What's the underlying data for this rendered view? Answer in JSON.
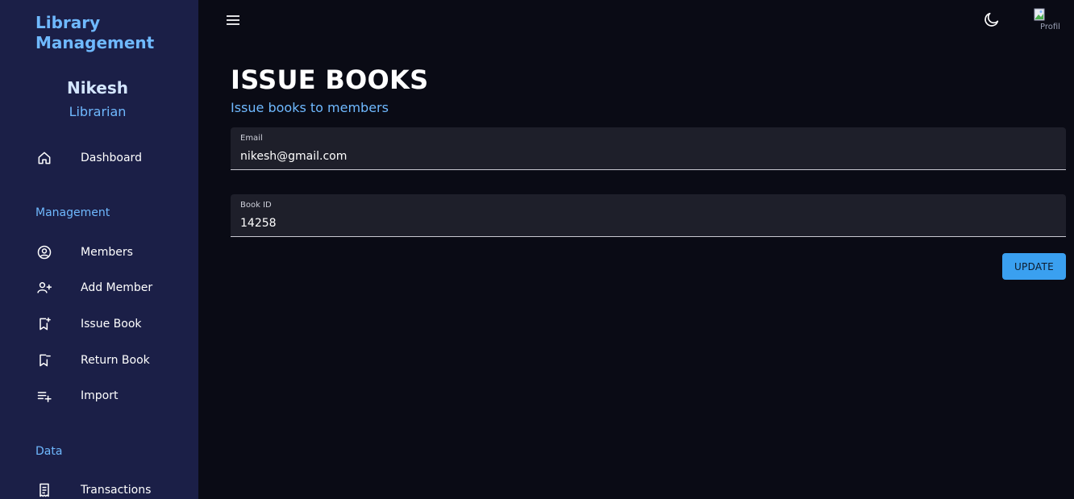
{
  "sidebar": {
    "brand": "Library Management",
    "user": {
      "name": "Nikesh",
      "role": "Librarian"
    },
    "items": [
      {
        "label": "Dashboard",
        "icon": "home-icon"
      }
    ],
    "sections": [
      {
        "title": "Management",
        "items": [
          {
            "label": "Members",
            "icon": "user-circle-icon"
          },
          {
            "label": "Add Member",
            "icon": "user-add-icon"
          },
          {
            "label": "Issue Book",
            "icon": "bookmark-add-icon"
          },
          {
            "label": "Return Book",
            "icon": "bookmark-return-icon"
          },
          {
            "label": "Import",
            "icon": "playlist-add-icon"
          }
        ]
      },
      {
        "title": "Data",
        "items": [
          {
            "label": "Transactions",
            "icon": "receipt-icon"
          }
        ]
      }
    ]
  },
  "topbar": {
    "menu_icon": "menu-icon",
    "theme_icon": "moon-icon",
    "avatar_alt": "Profile"
  },
  "main": {
    "title": "ISSUE BOOKS",
    "subtitle": "Issue books to members",
    "form": {
      "email": {
        "label": "Email",
        "value": "nikesh@gmail.com"
      },
      "book_id": {
        "label": "Book ID",
        "value": "14258"
      },
      "submit_label": "UPDATE"
    }
  },
  "colors": {
    "background": "#0a0b15",
    "sidebar": "#1b1f47",
    "accent": "#6fb9ff",
    "button": "#3aa0f0",
    "field": "#1e1f2a"
  }
}
